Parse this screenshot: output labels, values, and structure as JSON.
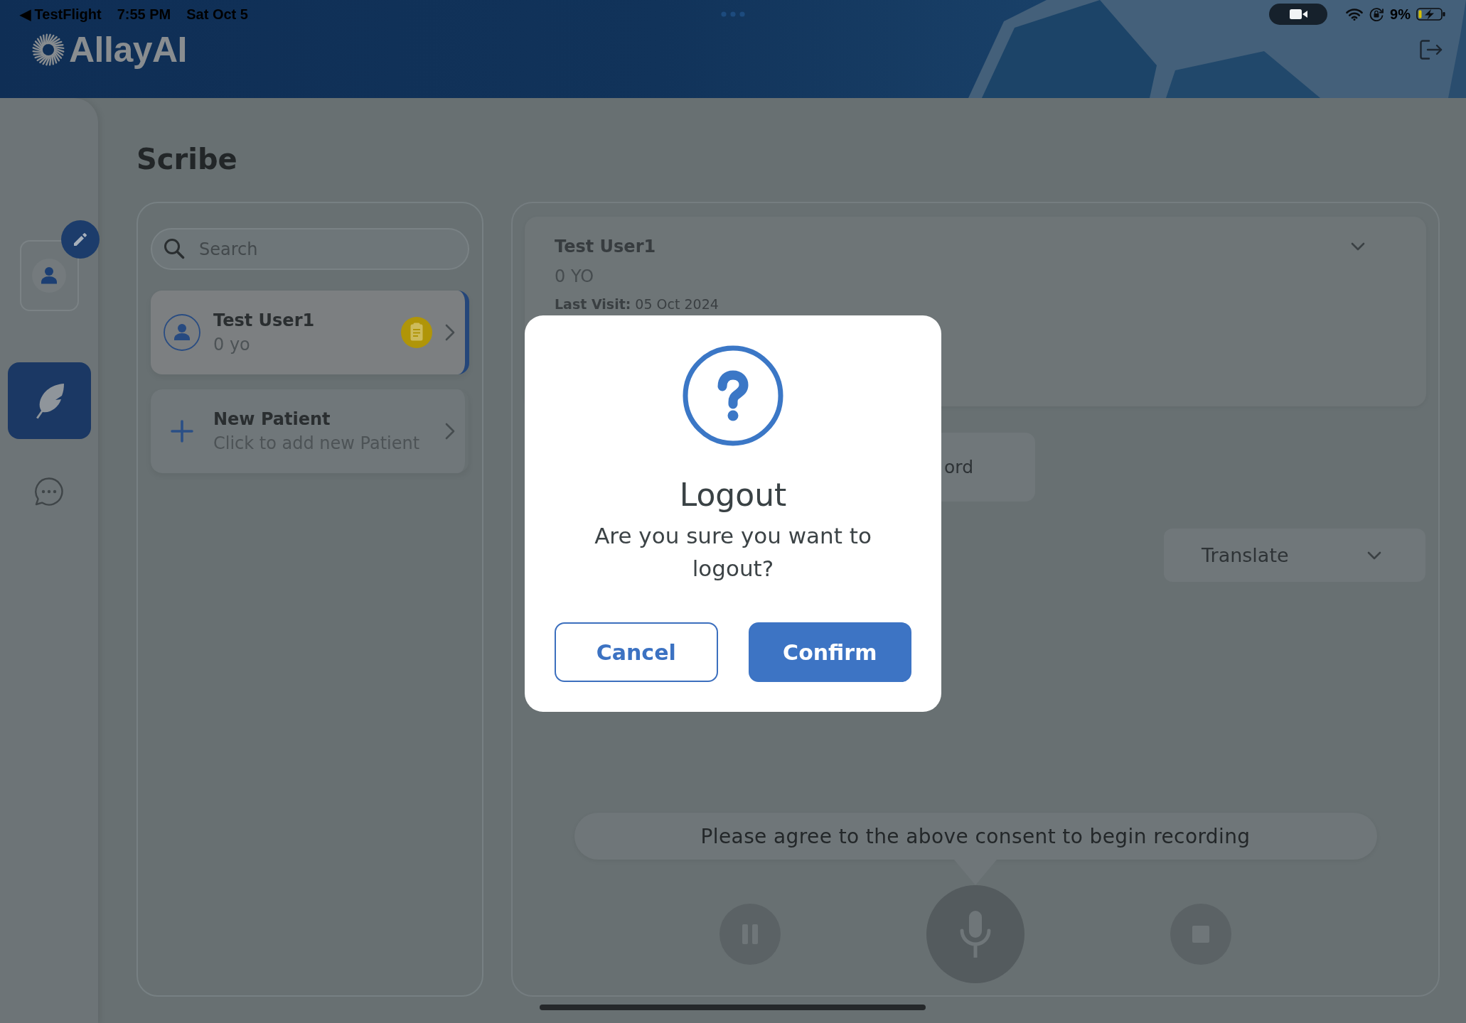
{
  "status_bar": {
    "back_link": "◀ TestFlight",
    "time": "7:55 PM",
    "date": "Sat Oct 5",
    "battery": "9%"
  },
  "header": {
    "logo_text": "AllayAI"
  },
  "sidebar": {
    "items": [
      {
        "kind": "profile",
        "selected": false
      },
      {
        "kind": "scribe",
        "selected": true
      },
      {
        "kind": "chat",
        "selected": false
      }
    ]
  },
  "page": {
    "title": "Scribe"
  },
  "patient_list": {
    "search": {
      "placeholder": "Search"
    },
    "items": [
      {
        "kind": "patient",
        "name": "Test User1",
        "detail": "0 yo",
        "selected": true
      },
      {
        "kind": "add",
        "name": "New Patient",
        "detail": "Click to add new Patient",
        "selected": false
      }
    ]
  },
  "patient_summary": {
    "name": "Test User1",
    "age": "0 YO",
    "last_visit": "**Last Visit:** 05 Oct 2024"
  },
  "partial_button": {
    "label": "ord"
  },
  "translate": {
    "label": "Translate"
  },
  "consent_message": "Please agree to the above consent to begin recording",
  "controls": [
    {
      "kind": "pause",
      "disabled": true
    },
    {
      "kind": "mic",
      "disabled": true
    },
    {
      "kind": "stop",
      "disabled": true
    }
  ],
  "dialog": {
    "title": "Logout",
    "message": "Are you sure you want to logout?",
    "buttons": [
      {
        "kind": "secondary",
        "label": "Cancel"
      },
      {
        "kind": "primary",
        "label": "Confirm"
      }
    ]
  }
}
